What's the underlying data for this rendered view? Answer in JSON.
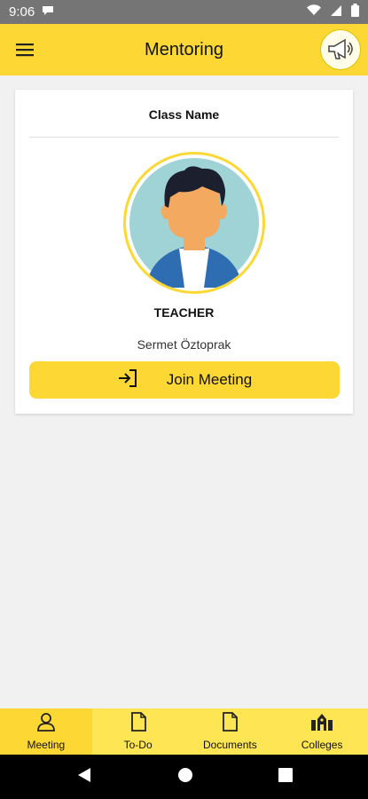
{
  "status_bar": {
    "time": "9:06"
  },
  "app_bar": {
    "title": "Mentoring"
  },
  "card": {
    "class_name": "Class Name",
    "role": "TEACHER",
    "person_name": "Sermet Öztoprak",
    "join_button_label": "Join Meeting"
  },
  "bottom_nav": {
    "items": [
      {
        "label": "Meeting",
        "icon": "person-icon",
        "active": true
      },
      {
        "label": "To-Do",
        "icon": "document-icon",
        "active": false
      },
      {
        "label": "Documents",
        "icon": "document-icon",
        "active": false
      },
      {
        "label": "Colleges",
        "icon": "college-icon",
        "active": false
      }
    ]
  },
  "colors": {
    "accent": "#fdd835",
    "nav_bg": "#fde554",
    "status_bar": "#757575"
  }
}
